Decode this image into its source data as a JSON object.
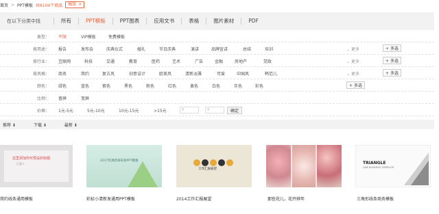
{
  "breadcrumb": {
    "home": "首页",
    "sep": ">",
    "current": "PPT模板",
    "count": "共8104个商品",
    "tag": "报告",
    "tag_close": "×"
  },
  "category_bar": {
    "title": "在以下分类中找",
    "tabs": [
      {
        "label": "所有",
        "active": false
      },
      {
        "label": "PPT模板",
        "active": true
      },
      {
        "label": "PPT图表",
        "active": false
      },
      {
        "label": "应用文书",
        "active": false
      },
      {
        "label": "表格",
        "active": false
      },
      {
        "label": "图片素材",
        "active": false
      },
      {
        "label": "PDF",
        "active": false
      }
    ]
  },
  "filters": {
    "more_label": "更多",
    "multi_label": "+ 多选",
    "rows": [
      {
        "label": "类型：",
        "options": [
          "不限",
          "VIP模板",
          "免费模板"
        ],
        "active": 0,
        "more": false,
        "multi": false
      },
      {
        "label": "按用途：",
        "options": [
          "报告",
          "发布会",
          "庆典仪式",
          "婚礼",
          "节日庆典",
          "演讲",
          "品牌宣讲",
          "总结",
          "培训"
        ],
        "more": true,
        "multi": true
      },
      {
        "label": "按行业：",
        "options": [
          "互联网",
          "科技",
          "交通",
          "教育",
          "医药",
          "艺术",
          "广告",
          "金融",
          "房地产",
          "党政"
        ],
        "more": true,
        "multi": true
      },
      {
        "label": "按风格：",
        "options": [
          "商务",
          "简约",
          "复古风",
          "创意设计",
          "欧美风",
          "清新淡雅",
          "可爱",
          "中国风",
          "韩范儿"
        ],
        "more": true,
        "multi": true
      },
      {
        "label": "颜色：",
        "options": [
          "绿色",
          "蓝色",
          "紫色",
          "黑色",
          "粉色",
          "红色",
          "黄色",
          "白色",
          "灰色",
          "彩色"
        ],
        "more": false,
        "multi": true
      },
      {
        "label": "比例：",
        "options": [
          "普屏",
          "宽屏"
        ],
        "more": false,
        "multi": false
      },
      {
        "label": "价格：",
        "options": [
          "1元-5元",
          "5元-10元",
          "10元-15元",
          ">15元"
        ],
        "more": false,
        "multi": false
      }
    ],
    "price_min_placeholder": "¥",
    "price_max_placeholder": "¥",
    "confirm_label": "确定"
  },
  "sort_bar": {
    "items": [
      "推荐 ⬇",
      "下载 ⬇",
      "最新 ⬇"
    ]
  },
  "products": [
    {
      "caption": "简约线条通用模板",
      "thumb_title": "这里添加你可预设的标题",
      "thumb_sub": "汇报人"
    },
    {
      "caption": "彩虹小清新发通用PPT模板",
      "thumb_title": "2017年清新发布会PPT模板"
    },
    {
      "caption": "2014工作汇报展望",
      "thumb_title": "工作汇报展望"
    },
    {
      "caption": "那些花儿，花开辨年",
      "thumb_title": ""
    },
    {
      "caption": "三角形线条商务模板",
      "thumb_title": "TRIANGLE",
      "thumb_sub": "LINE BUSINESS TEMPLATE"
    }
  ],
  "colors": {
    "accent": "#e8643c",
    "bar_bg": "#f2f2f2"
  }
}
